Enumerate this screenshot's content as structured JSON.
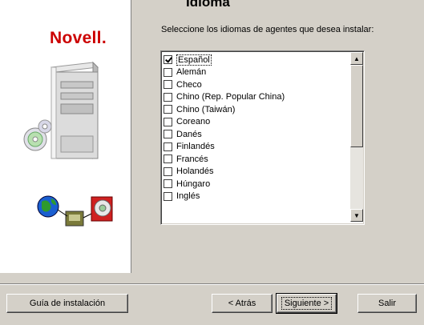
{
  "header": {
    "title": "Idioma"
  },
  "brand": {
    "logo": "Novell."
  },
  "content": {
    "instruction": "Seleccione los idiomas de agentes que desea instalar:",
    "languages": [
      {
        "label": "Español",
        "checked": true
      },
      {
        "label": "Alemán",
        "checked": false
      },
      {
        "label": "Checo",
        "checked": false
      },
      {
        "label": "Chino (Rep. Popular China)",
        "checked": false
      },
      {
        "label": "Chino (Taiwán)",
        "checked": false
      },
      {
        "label": "Coreano",
        "checked": false
      },
      {
        "label": "Danés",
        "checked": false
      },
      {
        "label": "Finlandés",
        "checked": false
      },
      {
        "label": "Francés",
        "checked": false
      },
      {
        "label": "Holandés",
        "checked": false
      },
      {
        "label": "Húngaro",
        "checked": false
      },
      {
        "label": "Inglés",
        "checked": false
      }
    ]
  },
  "buttons": {
    "guide": "Guía de instalación",
    "back": "< Atrás",
    "next": "Siguiente >",
    "exit": "Salir"
  },
  "icons": {
    "scroll_up": "scroll-up-arrow-icon",
    "scroll_down": "scroll-down-arrow-icon"
  },
  "colors": {
    "brand_red": "#cc0000",
    "dialog_bg": "#d4d0c8"
  }
}
